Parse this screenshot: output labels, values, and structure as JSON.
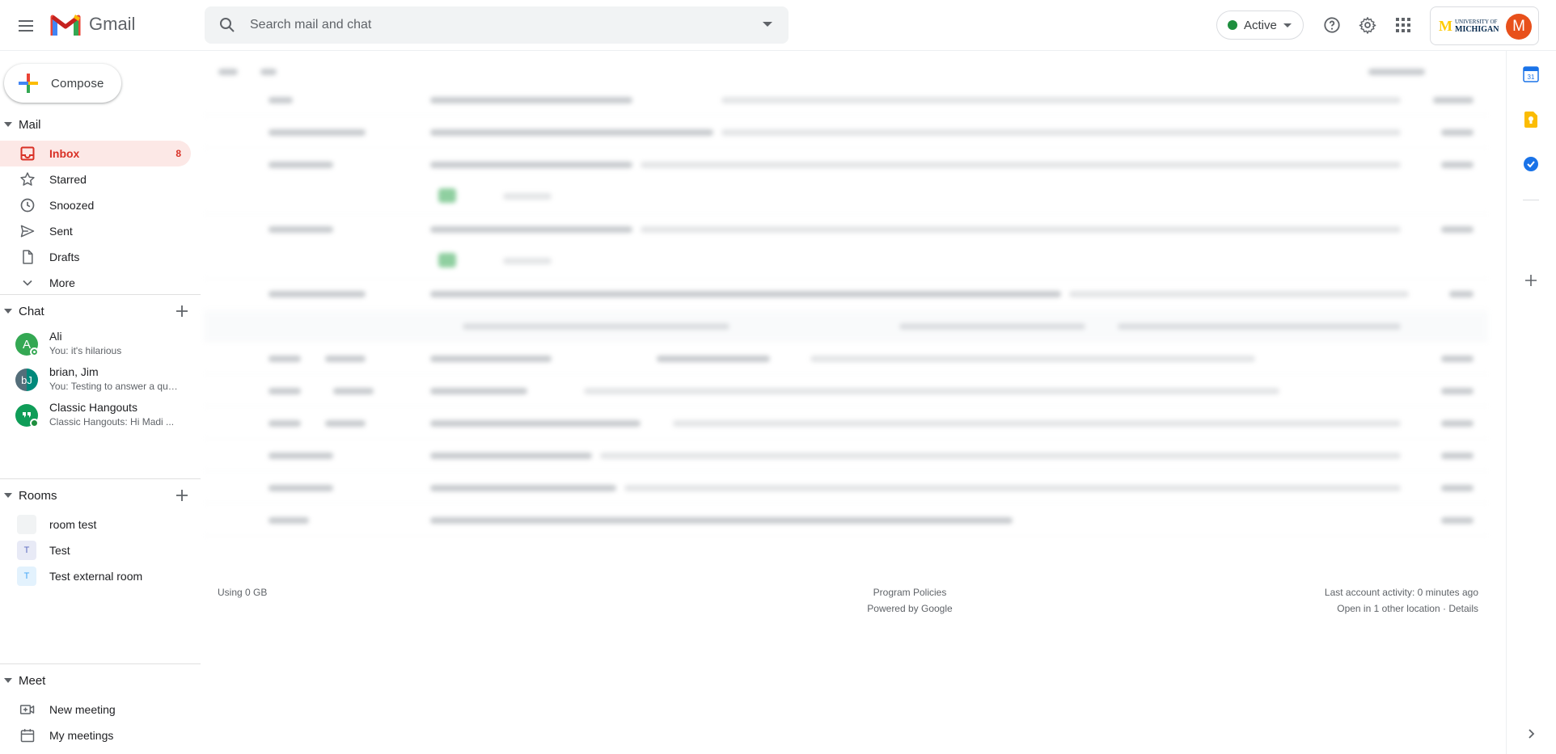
{
  "header": {
    "app_name": "Gmail",
    "search_placeholder": "Search mail and chat",
    "status": "Active",
    "status_color": "#1e8e3e",
    "account_org": {
      "line1": "UNIVERSITY OF",
      "line2": "MICHIGAN"
    },
    "avatar_letter": "M",
    "avatar_color": "#e8501b"
  },
  "compose": {
    "label": "Compose"
  },
  "mail": {
    "section_label": "Mail",
    "items": [
      {
        "label": "Inbox",
        "count": "8",
        "icon": "inbox-icon",
        "active": true
      },
      {
        "label": "Starred",
        "icon": "star-icon"
      },
      {
        "label": "Snoozed",
        "icon": "clock-icon"
      },
      {
        "label": "Sent",
        "icon": "send-icon"
      },
      {
        "label": "Drafts",
        "icon": "draft-icon"
      },
      {
        "label": "More",
        "icon": "chevron-down-icon"
      }
    ]
  },
  "chat": {
    "section_label": "Chat",
    "items": [
      {
        "name": "Ali",
        "snippet": "You: it's hilarious",
        "avatar": "A"
      },
      {
        "name": "brian, Jim",
        "snippet": "You: Testing to answer a question",
        "avatar": "bJ"
      },
      {
        "name": "Classic Hangouts",
        "snippet": "Classic Hangouts: Hi Madi ...",
        "avatar": "hangouts"
      }
    ]
  },
  "rooms": {
    "section_label": "Rooms",
    "items": [
      {
        "label": "room test",
        "tile": "",
        "tile_color": "#f1f3f4"
      },
      {
        "label": "Test",
        "tile": "T",
        "tile_color": "#e8eaf6"
      },
      {
        "label": "Test external room",
        "tile": "T",
        "tile_color": "#e3f2fd"
      }
    ]
  },
  "meet": {
    "section_label": "Meet",
    "items": [
      {
        "label": "New meeting",
        "icon": "video-add-icon"
      },
      {
        "label": "My meetings",
        "icon": "calendar-icon"
      }
    ]
  },
  "footer": {
    "storage": "Using 0 GB",
    "policies": "Program Policies",
    "powered": "Powered by Google",
    "activity": "Last account activity: 0 minutes ago",
    "locations": "Open in 1 other location · Details"
  }
}
